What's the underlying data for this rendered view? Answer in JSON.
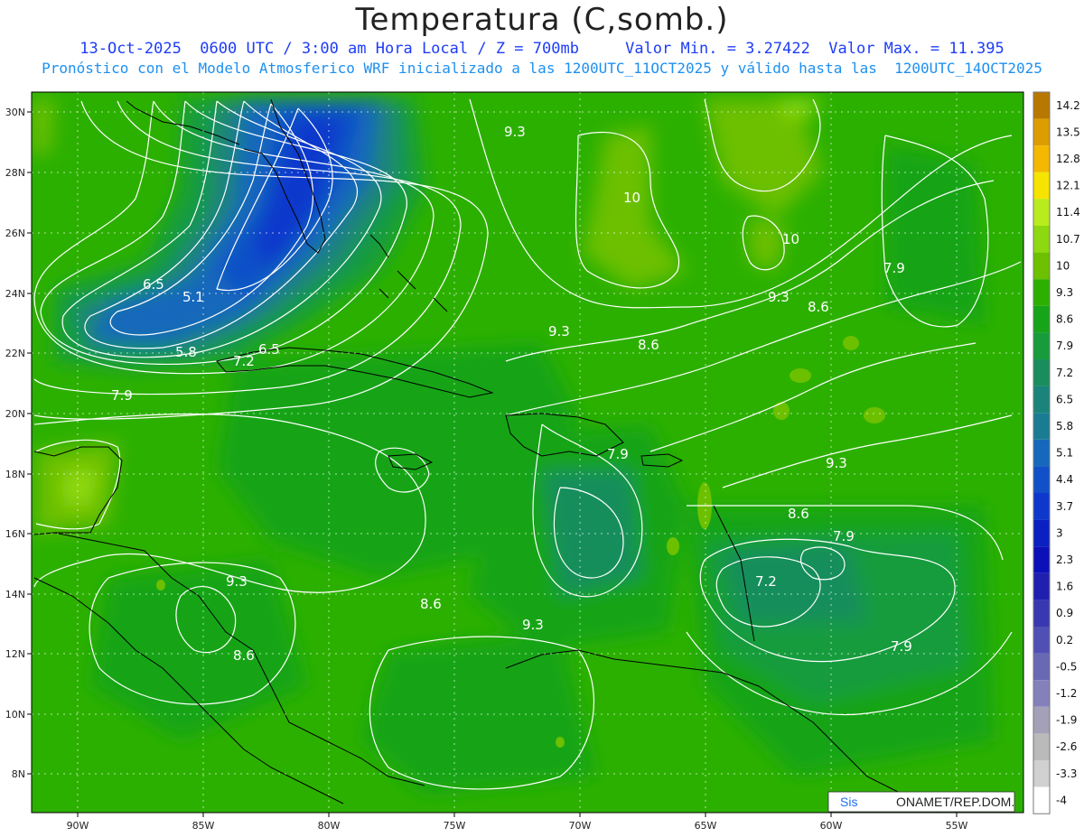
{
  "title": "Temperatura (C,somb.)",
  "subtitle_line1": "13-Oct-2025  0600 UTC / 3:00 am Hora Local / Z = 700mb     Valor Min. = 3.27422  Valor Max. = 11.395",
  "subtitle_line2": "Pronóstico con el Modelo Atmosferico WRF inicializado a las 1200UTC_11OCT2025 y válido hasta las  1200UTC_14OCT2025",
  "map": {
    "lon_labels": [
      "90W",
      "85W",
      "80W",
      "75W",
      "70W",
      "65W",
      "60W",
      "55W"
    ],
    "lat_labels": [
      "30N",
      "28N",
      "26N",
      "24N",
      "22N",
      "20N",
      "18N",
      "16N",
      "14N",
      "12N",
      "10N",
      "8N"
    ],
    "contour_labels": [
      "9.3",
      "10",
      "10",
      "7.9",
      "6.5",
      "5.1",
      "9.3",
      "9.3",
      "8.6",
      "5.8",
      "6.5",
      "7.2",
      "8.6",
      "7.9",
      "9.3",
      "7.9",
      "8.6",
      "7.9",
      "9.3",
      "7.2",
      "7.9",
      "8.6",
      "9.3",
      "8.6"
    ]
  },
  "legend": {
    "labels": [
      "14.2",
      "13.5",
      "12.8",
      "12.1",
      "11.4",
      "10.7",
      "10",
      "9.3",
      "8.6",
      "7.9",
      "7.2",
      "6.5",
      "5.8",
      "5.1",
      "4.4",
      "3.7",
      "3",
      "2.3",
      "1.6",
      "0.9",
      "0.2",
      "-0.5",
      "-1.2",
      "-1.9",
      "-2.6",
      "-3.3",
      "-4"
    ],
    "colors": [
      "#b87800",
      "#dd9c00",
      "#f4b800",
      "#f6e400",
      "#b8ec1c",
      "#8ed810",
      "#6cc000",
      "#2cb000",
      "#16a418",
      "#179c3c",
      "#188e5c",
      "#1a847a",
      "#1a7c92",
      "#1668bc",
      "#1050c8",
      "#0e38cc",
      "#0a20c0",
      "#0c10b8",
      "#2020b0",
      "#3838b0",
      "#5050b4",
      "#6868b4",
      "#8480bc",
      "#a4a0b8",
      "#bababa",
      "#d0d0d0",
      "#ffffff"
    ]
  },
  "credit": {
    "prefix": "Sis",
    "suffix": "ONAMET/REP.DOM."
  }
}
